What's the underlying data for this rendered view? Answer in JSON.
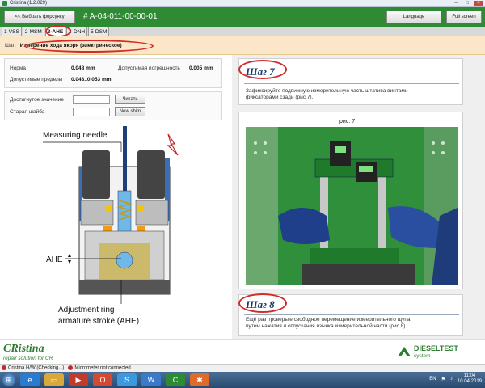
{
  "window": {
    "title": "Cristina (1.2.029)"
  },
  "header": {
    "select_button": "<< Выбрать форсунку",
    "order_number": "# A-04-011-00-00-01",
    "language_button": "Language",
    "fullscreen_button": "Full screen"
  },
  "tabs": [
    {
      "label": "1-VSS"
    },
    {
      "label": "2-MSM"
    },
    {
      "label": "3-AHE"
    },
    {
      "label": "4-DNH"
    },
    {
      "label": "5-DSM"
    }
  ],
  "stepbar": {
    "label": "Шаг:",
    "value": "Измерение хода якоря (электрическое)"
  },
  "params": {
    "norm_label": "Норма",
    "norm_value": "0.048 mm",
    "tol_label": "Допустимая погрешность",
    "tol_value": "0.005 mm",
    "limits_label": "Допустимые пределы",
    "limits_value": "0.043..0.053 mm"
  },
  "inputs": {
    "reached_label": "Достигнутое значение",
    "old_shim_label": "Старая шайба",
    "read_button": "Читать",
    "new_shim_button": "New shim"
  },
  "diagram": {
    "needle_label": "Measuring needle",
    "ahe_label": "AHE",
    "ring_line1": "Adjustment ring",
    "ring_line2": "armature stroke (AHE)"
  },
  "step7": {
    "title": "Шаг 7",
    "text1": "Зафиксируйте подвижную измерительную часть штатива винтами-",
    "text2": "фиксаторами сзади (рис.7).",
    "figure_caption": "рис. 7"
  },
  "step8": {
    "title": "Шаг 8",
    "text1": "Ещё раз проверьте свободное перемещение измерительного щупа",
    "text2": "путем нажатия и отпускания язычка измерительной части (рис.8)."
  },
  "footer": {
    "brand": "CRistina",
    "brand_sub": "repair solution for CR",
    "brand2": "DIESELTEST",
    "brand2_sub": "system"
  },
  "status": {
    "item1": "Cristina H/W (Checking...)",
    "item2": "Micrometer not connected"
  },
  "taskbar": {
    "lang": "EN",
    "time": "11:04",
    "date": "10.04.2019"
  },
  "colors": {
    "green": "#2e8b34",
    "annotation_red": "#d42a2a",
    "step_title": "#1a3a6a"
  }
}
